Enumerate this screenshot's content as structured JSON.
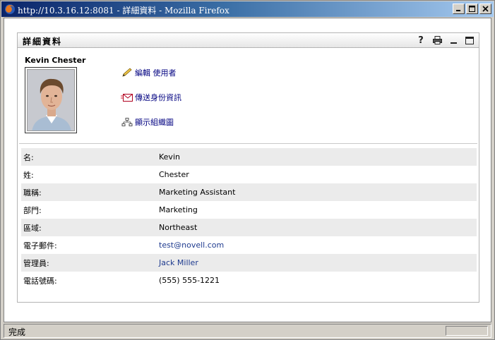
{
  "window": {
    "title": "http://10.3.16.12:8081 - 詳細資料 - Mozilla Firefox"
  },
  "portlet": {
    "title": "詳細資料",
    "tools": {
      "help": "?"
    }
  },
  "profile": {
    "name": "Kevin Chester",
    "actions": [
      {
        "label": "編輯 使用者",
        "icon": "pencil-icon"
      },
      {
        "label": "傳送身份資訊",
        "icon": "envelope-icon"
      },
      {
        "label": "顯示組織圖",
        "icon": "org-chart-icon"
      }
    ]
  },
  "details": [
    {
      "label": "名:",
      "value": "Kevin"
    },
    {
      "label": "姓:",
      "value": "Chester"
    },
    {
      "label": "職稱:",
      "value": "Marketing Assistant"
    },
    {
      "label": "部門:",
      "value": "Marketing"
    },
    {
      "label": "區域:",
      "value": "Northeast"
    },
    {
      "label": "電子郵件:",
      "value": "test@novell.com"
    },
    {
      "label": "管理員:",
      "value": "Jack Miller"
    },
    {
      "label": "電話號碼:",
      "value": "(555) 555-1221"
    }
  ],
  "status": {
    "text": "完成"
  },
  "colors": {
    "link": "#1f3b8f",
    "action_link": "#000080",
    "row_alt": "#ebebeb"
  }
}
